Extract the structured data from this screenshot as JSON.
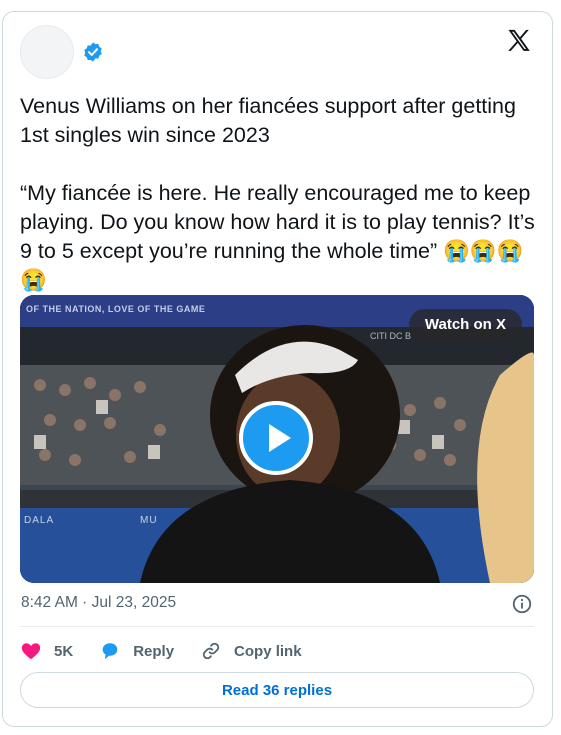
{
  "tweet": {
    "text_line1": "Venus Williams on her fiancées support after getting 1st singles win since 2023",
    "text_line2": "“My fiancée is here. He really encouraged me to keep playing. Do you know how hard it is to play tennis? It’s 9 to 5 except you’re running the whole time” 😭😭😭😭",
    "timestamp": "8:42 AM · Jul 23, 2025"
  },
  "media": {
    "watch_label": "Watch on X",
    "banner_text": "OF THE NATION, LOVE OF THE GAME",
    "sign_left": "DALA",
    "sign_mid": "MU",
    "sign_right": "CITI DC B"
  },
  "actions": {
    "likes": "5K",
    "reply_label": "Reply",
    "copy_label": "Copy link",
    "read_replies": "Read 36 replies"
  },
  "colors": {
    "like": "#f91880",
    "reply": "#1d9bf0",
    "link": "#006fd6",
    "muted": "#536471"
  }
}
